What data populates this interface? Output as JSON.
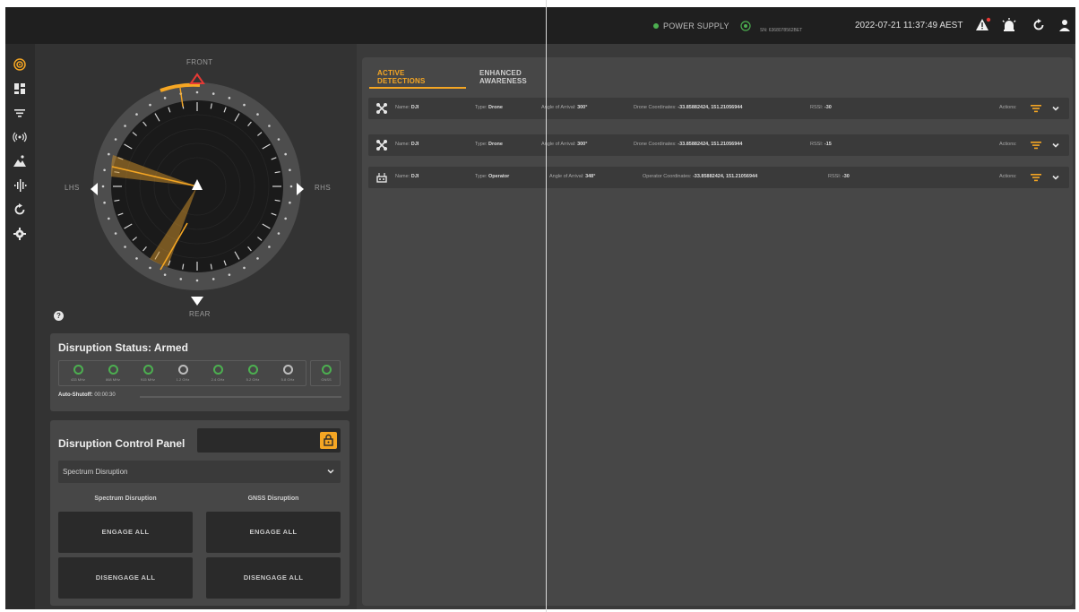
{
  "topbar": {
    "power_label": "POWER SUPPLY",
    "serial_number": "SN: 6368078562BET",
    "datetime": "2022-07-21 11:37:49 AEST",
    "icons": [
      "alert-icon",
      "alarm-icon",
      "refresh-icon",
      "user-icon"
    ]
  },
  "sidebar": {
    "items": [
      "sensor-icon",
      "dashboard-icon",
      "filter-icon",
      "signal-icon",
      "terrain-icon",
      "spectrum-icon",
      "refresh-icon",
      "settings-icon"
    ]
  },
  "radar": {
    "front": "FRONT",
    "rear": "REAR",
    "left": "LHS",
    "right": "RHS",
    "help": "?"
  },
  "disruption_status": {
    "title": "Disruption Status: Armed",
    "bands": [
      {
        "label": "433 MHz",
        "on": true
      },
      {
        "label": "868 MHz",
        "on": true
      },
      {
        "label": "915 MHz",
        "on": true
      },
      {
        "label": "1.2 GHz",
        "on": false
      },
      {
        "label": "2.4 GHz",
        "on": true
      },
      {
        "label": "5.2 GHz",
        "on": true
      },
      {
        "label": "5.8 GHz",
        "on": false
      }
    ],
    "gnss": {
      "label": "GNSS",
      "on": true
    },
    "auto_shutoff_label": "Auto-Shutoff:",
    "auto_shutoff_value": "00:00:30"
  },
  "control_panel": {
    "title": "Disruption Control Panel",
    "mode": "Spectrum Disruption",
    "spectrum_heading": "Spectrum Disruption",
    "gnss_heading": "GNSS Disruption",
    "engage_label": "ENGAGE ALL",
    "disengage_label": "DISENGAGE ALL"
  },
  "tabs": {
    "active": "ACTIVE DETECTIONS",
    "enhanced": "ENHANCED AWARENESS"
  },
  "detections": [
    {
      "icon": "drone-icon",
      "name_label": "Name:",
      "name": "DJI",
      "type_label": "Type:",
      "type": "Drone",
      "angle_label": "Angle of Arrival:",
      "angle": "300°",
      "coords_label": "Drone Coordinates:",
      "coords": "-33.85882424, 151.21056944",
      "rssi_label": "RSSI:",
      "rssi": "-30",
      "actions_label": "Actions:"
    },
    {
      "icon": "drone-icon",
      "name_label": "Name:",
      "name": "DJI",
      "type_label": "Type:",
      "type": "Drone",
      "angle_label": "Angle of Arrival:",
      "angle": "300°",
      "coords_label": "Drone Coordinates:",
      "coords": "-33.85882424, 151.21056944",
      "rssi_label": "RSSI:",
      "rssi": "-15",
      "actions_label": "Actions:"
    },
    {
      "icon": "operator-icon",
      "name_label": "Name:",
      "name": "DJI",
      "type_label": "Type:",
      "type": "Operator",
      "angle_label": "Angle of Arrival:",
      "angle": "348°",
      "coords_label": "Operator Coordinates:",
      "coords": "-33.85882424, 151.21056944",
      "rssi_label": "RSSI:",
      "rssi": "-30",
      "actions_label": "Actions:"
    }
  ],
  "colors": {
    "accent": "#f5a623",
    "ok": "#4caf50",
    "alert": "#e53935"
  }
}
